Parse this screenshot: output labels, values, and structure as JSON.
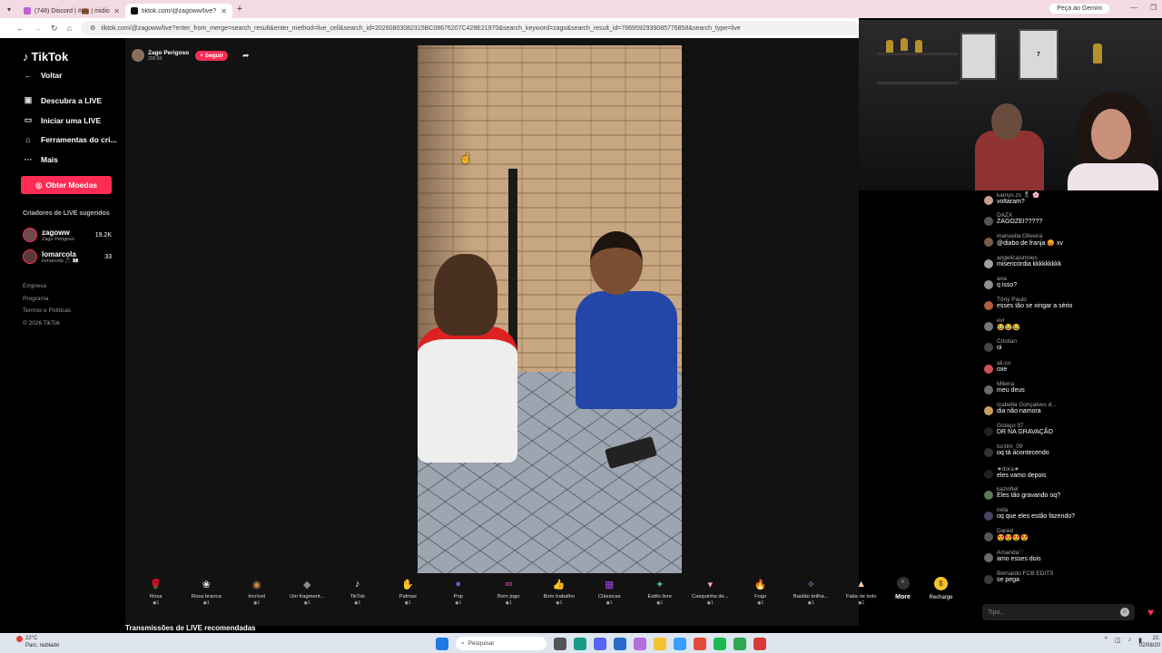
{
  "browser": {
    "tabs": [
      {
        "title": "(748) Discord | #💼 | midio",
        "favicon_color": "#c05dd6",
        "active": false
      },
      {
        "title": "tiktok.com/@zagoww/live?",
        "favicon_color": "#111111",
        "active": true
      }
    ],
    "gemini_label": "Peça ao Gemini",
    "url": "tiktok.com/@zagoww/live?enter_from_merge=search_result&enter_method=live_cell&search_id=20260803082315BC08676207C428E21970&search_keyword=zago&search_result_id=7669592939085776858&search_type=live"
  },
  "sidebar": {
    "logo": "TikTok",
    "nav": [
      {
        "label": "Voltar",
        "icon": "back-arrow-icon",
        "glyph": "←"
      },
      {
        "label": "Descubra a LIVE",
        "icon": "calendar-icon",
        "glyph": "▣"
      },
      {
        "label": "Iniciar uma LIVE",
        "icon": "camera-icon",
        "glyph": "▭"
      },
      {
        "label": "Ferramentas do cri...",
        "icon": "home-icon",
        "glyph": "⌂"
      },
      {
        "label": "Mais",
        "icon": "more-dots-icon",
        "glyph": "···"
      }
    ],
    "coins_button": "Obter Moedas",
    "suggested_title": "Criadores de LIVE sugeridos",
    "creators": [
      {
        "name": "zagoww",
        "sub": "Zago Perigoso",
        "count": "19.2K"
      },
      {
        "name": "lomarcola",
        "sub": "lomarcola 🎵 👀",
        "count": "33"
      }
    ],
    "footer_links": [
      "Empresa",
      "Programa",
      "Termos e Políticas",
      "© 2026 TikTok"
    ]
  },
  "stream": {
    "host_name": "Zago Perigoso",
    "host_viewers": "206.6K",
    "follow_label": "+ Seguir",
    "recommended_title": "Transmissões de LIVE recomendadas"
  },
  "gifts": [
    {
      "name": "Rosa",
      "cost": "1",
      "glyph": "🌹",
      "color": "#e0234e"
    },
    {
      "name": "Rosa branca",
      "cost": "1",
      "glyph": "❀",
      "color": "#e9f0d6"
    },
    {
      "name": "Incrível",
      "cost": "1",
      "glyph": "◉",
      "color": "#c98a4a"
    },
    {
      "name": "Um fragment...",
      "cost": "1",
      "glyph": "◆",
      "color": "#8c8c8c"
    },
    {
      "name": "TikTok",
      "cost": "1",
      "glyph": "♪",
      "color": "#f2e8ff"
    },
    {
      "name": "Palmas",
      "cost": "1",
      "glyph": "✋",
      "color": "#e9b23c"
    },
    {
      "name": "Pop",
      "cost": "1",
      "glyph": "●",
      "color": "#7d58d8"
    },
    {
      "name": "Bom jogo",
      "cost": "1",
      "glyph": "∞",
      "color": "#e35bc4"
    },
    {
      "name": "Bom trabalho",
      "cost": "1",
      "glyph": "👍",
      "color": "#f0b530"
    },
    {
      "name": "Clássicas",
      "cost": "1",
      "glyph": "▦",
      "color": "#9b3fd6"
    },
    {
      "name": "Estilo livre",
      "cost": "1",
      "glyph": "✦",
      "color": "#3cc8a0"
    },
    {
      "name": "Casquinha de...",
      "cost": "1",
      "glyph": "▾",
      "color": "#f2a7c8"
    },
    {
      "name": "Fogo",
      "cost": "1",
      "glyph": "🔥",
      "color": "#f07a1e"
    },
    {
      "name": "Bastão brilha...",
      "cost": "1",
      "glyph": "✧",
      "color": "#c68df0"
    },
    {
      "name": "Fatia de bolo",
      "cost": "1",
      "glyph": "▲",
      "color": "#f2c6a0"
    }
  ],
  "gift_more_label": "More",
  "recharge_label": "Recharge",
  "chat": {
    "messages": [
      {
        "user": "kamys.zs 🎖 🌸",
        "text": "voltaram?",
        "avatar_color": "#c9a08c"
      },
      {
        "user": "DAZX",
        "text": "ZAGOZEI?????",
        "avatar_color": "#555555"
      },
      {
        "user": "manuella Oliveira",
        "text": "@diabo de franja 😡 xv",
        "avatar_color": "#7a5a4a"
      },
      {
        "user": "angelicasimoes",
        "text": "misericórdia kkkkkkkkk",
        "avatar_color": "#a0a0a0"
      },
      {
        "user": "ana",
        "text": "q isso?",
        "avatar_color": "#8f8f8f"
      },
      {
        "user": "Tôný Paulo",
        "text": "esses tão se xingar a sério",
        "avatar_color": "#b06040"
      },
      {
        "user": "evi",
        "text": "😂😂😂",
        "avatar_color": "#777777"
      },
      {
        "user": "Cristian",
        "text": "oi",
        "avatar_color": "#444444"
      },
      {
        "user": "ali.co",
        "text": "oxe",
        "avatar_color": "#d05050"
      },
      {
        "user": "Milena",
        "text": "meu deus",
        "avatar_color": "#6c6c6c"
      },
      {
        "user": "Izabella Gonçalves d...",
        "text": "dia não namora",
        "avatar_color": "#c9a060"
      },
      {
        "user": "Golaço 97",
        "text": "DR NA GRAVAÇÃO",
        "avatar_color": "#222222"
      },
      {
        "user": "turzim_09",
        "text": "oq tá acontecendo",
        "avatar_color": "#333333"
      },
      {
        "user": "★dora★",
        "text": "eles vamo depois",
        "avatar_color": "#202020"
      },
      {
        "user": "kazinfiel",
        "text": "Eles tão gravando oq?",
        "avatar_color": "#5a7a5a"
      },
      {
        "user": "irela",
        "text": "oq que eles estão fazendo?",
        "avatar_color": "#444466"
      },
      {
        "user": "Daniel",
        "text": "😍😍😍😍",
        "avatar_color": "#555555"
      },
      {
        "user": "Amanda♡",
        "text": "amo esses dois",
        "avatar_color": "#6a6a6a"
      },
      {
        "user": "Bernardo FCB EDITS",
        "text": "se pega",
        "avatar_color": "#3a3a3a"
      }
    ],
    "input_placeholder": "Tipo..."
  },
  "webcam": {
    "jersey_label": "7"
  },
  "taskbar": {
    "weather_temp": "22°C",
    "weather_desc": "Parc. nublado",
    "search_placeholder": "Pesquisar",
    "time": "21:",
    "date": "02/08/20"
  }
}
